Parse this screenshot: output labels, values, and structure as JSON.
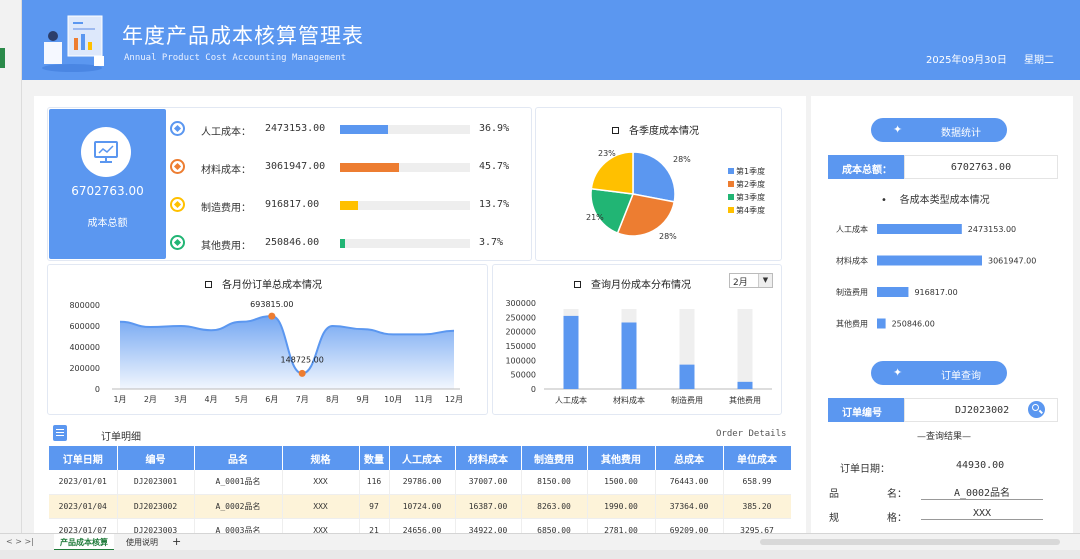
{
  "header": {
    "title": "年度产品成本核算管理表",
    "subtitle": "Annual Product Cost Accounting Management",
    "date": "2025年09月30日",
    "weekday": "星期二"
  },
  "summary": {
    "total_value": "6702763.00",
    "total_label": "成本总额",
    "items": [
      {
        "name": "人工成本：",
        "value": "2473153.00",
        "percent": "36.9%",
        "fraction": 0.369,
        "color": "#5b97f0"
      },
      {
        "name": "材料成本：",
        "value": "3061947.00",
        "percent": "45.7%",
        "fraction": 0.457,
        "color": "#ed7d31"
      },
      {
        "name": "制造费用：",
        "value": "916817.00",
        "percent": "13.7%",
        "fraction": 0.137,
        "color": "#ffc000"
      },
      {
        "name": "其他费用：",
        "value": "250846.00",
        "percent": "3.7%",
        "fraction": 0.037,
        "color": "#21b574"
      }
    ]
  },
  "chart_data": [
    {
      "type": "pie",
      "title": "各季度成本情况",
      "labels": [
        "第1季度",
        "第2季度",
        "第3季度",
        "第4季度"
      ],
      "values": [
        28,
        28,
        21,
        23
      ],
      "data_labels": [
        "28%",
        "28%",
        "21%",
        "23%"
      ],
      "colors": [
        "#5b97f0",
        "#ed7d31",
        "#21b574",
        "#ffc000"
      ],
      "legend": "right"
    },
    {
      "type": "area",
      "title": "各月份订单总成本情况",
      "categories": [
        "1月",
        "2月",
        "3月",
        "4月",
        "5月",
        "6月",
        "7月",
        "8月",
        "9月",
        "10月",
        "11月",
        "12月"
      ],
      "values": [
        640000,
        590000,
        600000,
        560000,
        640000,
        693815,
        148725,
        600000,
        570000,
        520000,
        520000,
        555000
      ],
      "annotations": [
        "693815.00",
        "148725.00"
      ],
      "y_ticks": [
        "800000",
        "600000",
        "400000",
        "200000",
        "0"
      ],
      "ylim": [
        0,
        800000
      ]
    },
    {
      "type": "bar",
      "title": "查询月份成本分布情况",
      "categories": [
        "人工成本",
        "材料成本",
        "制造费用",
        "其他费用"
      ],
      "values": [
        255000,
        232000,
        85000,
        25000
      ],
      "y_ticks": [
        "300000",
        "250000",
        "200000",
        "150000",
        "100000",
        "50000",
        "0"
      ],
      "ylim": [
        0,
        300000
      ]
    },
    {
      "type": "bar",
      "title": "各成本类型成本情况",
      "categories": [
        "人工成本",
        "材料成本",
        "制造费用",
        "其他费用"
      ],
      "values": [
        2473153,
        3061947,
        916817,
        250846
      ],
      "data_labels": [
        "2473153.00",
        "3061947.00",
        "916817.00",
        "250846.00"
      ]
    }
  ],
  "month_select": {
    "value": "2月"
  },
  "orders": {
    "title": "订单明细",
    "subtitle": "Order Details",
    "columns": [
      "订单日期",
      "编号",
      "品名",
      "规格",
      "数量",
      "人工成本",
      "材料成本",
      "制造费用",
      "其他费用",
      "总成本",
      "单位成本"
    ],
    "rows": [
      [
        "2023/01/01",
        "DJ2023001",
        "A_0001品名",
        "XXX",
        "116",
        "29786.00",
        "37007.00",
        "8150.00",
        "1500.00",
        "76443.00",
        "658.99"
      ],
      [
        "2023/01/04",
        "DJ2023002",
        "A_0002品名",
        "XXX",
        "97",
        "10724.00",
        "16387.00",
        "8263.00",
        "1990.00",
        "37364.00",
        "385.20"
      ],
      [
        "2023/01/07",
        "DJ2023003",
        "A_0003品名",
        "XXX",
        "21",
        "24656.00",
        "34922.00",
        "6850.00",
        "2781.00",
        "69209.00",
        "3295.67"
      ]
    ]
  },
  "sidebar": {
    "stats_button": "数据统计",
    "total_label": "成本总额：",
    "total_value": "6702763.00",
    "types_title": "各成本类型成本情况",
    "query_button": "订单查询",
    "order_no_label": "订单编号",
    "order_no_value": "DJ2023002",
    "result_title": "—查询结果—",
    "result_date_label": "订单日期：",
    "result_date_value": "44930.00",
    "result_name_label1": "品",
    "result_name_label2": "名：",
    "result_name_value": "A_0002品名",
    "result_spec_label1": "规",
    "result_spec_label2": "格：",
    "result_spec_value": "XXX"
  },
  "tabs": [
    "产品成本核算",
    "使用说明"
  ],
  "colors": {
    "accent": "#5b97f0",
    "header": "#5b97f0"
  }
}
